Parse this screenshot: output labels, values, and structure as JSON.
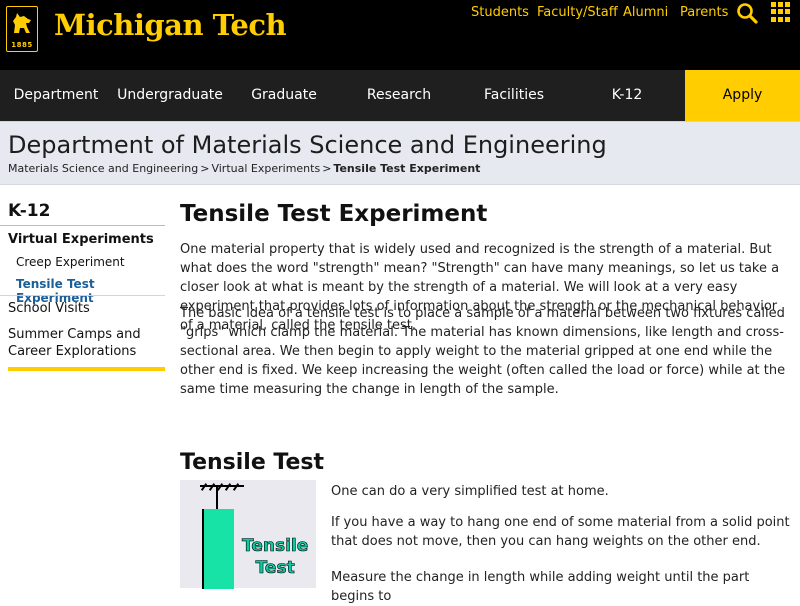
{
  "header": {
    "logo_year": "1885",
    "brand": "Michigan Tech",
    "utility_links": [
      "Students",
      "Faculty/Staff",
      "Alumni",
      "Parents"
    ],
    "icons": {
      "search": "search-icon",
      "apps": "grid-icon"
    },
    "colors": {
      "brand_gold": "#ffcd00",
      "header_bg": "#000000",
      "nav_bg": "#1f1f1f"
    }
  },
  "nav": {
    "items": [
      "Department",
      "Undergraduate",
      "Graduate",
      "Research",
      "Facilities",
      "K-12"
    ],
    "apply": "Apply"
  },
  "banner": {
    "title": "Department of Materials Science and Engineering",
    "breadcrumb": [
      "Materials Science and Engineering",
      "Virtual Experiments",
      "Tensile Test Experiment"
    ],
    "separator": ">"
  },
  "sidebar": {
    "heading": "K-12",
    "section": "Virtual Experiments",
    "subitems": [
      "Creep Experiment",
      "Tensile Test Experiment"
    ],
    "items": [
      "School Visits",
      "Summer Camps and Career Explorations"
    ],
    "active_color": "#1a5e9a"
  },
  "content": {
    "title": "Tensile Test Experiment",
    "paragraphs": [
      "One material property that is widely used and recognized is the strength of a material. But what does the word \"strength\" mean? \"Strength\" can have many meanings, so let us take a closer look at what is meant by the strength of a material. We will look at a very easy experiment that provides lots of information about the strength or the mechanical behavior of a material, called the tensile test.",
      "The basic idea of a tensile test is to place a sample of a material between two fixtures called \"grips\" which clamp the material. The material has known dimensions, like length and cross-sectional area. We then begin to apply weight to the material gripped at one end while the other end is fixed. We keep increasing the weight (often called the load or force) while at the same time measuring the change in length of the sample."
    ],
    "subtitle": "Tensile Test",
    "figure_label": [
      "Tensile",
      "Test"
    ],
    "figure_paragraphs": [
      "One can do a very simplified test at home.",
      "If you have a way to hang one end of some material from a solid point that does not move, then you can hang weights on the other end.",
      "Measure the change in length while adding weight until the part begins to"
    ]
  }
}
